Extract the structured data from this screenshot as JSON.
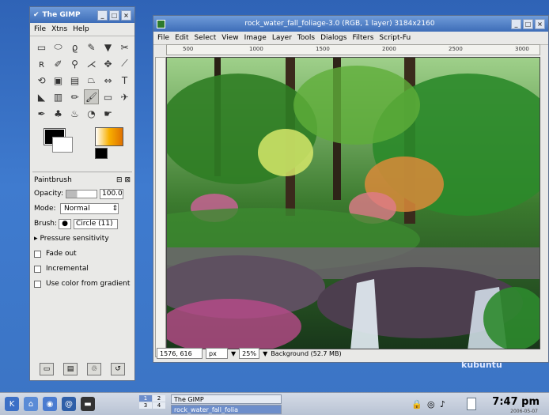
{
  "toolbox": {
    "title": "The GIMP",
    "menu": [
      "File",
      "Xtns",
      "Help"
    ],
    "tools": [
      "rect-select",
      "ellipse-select",
      "lasso",
      "fuzzy-select",
      "color-select",
      "scissors",
      "paths",
      "color-picker",
      "zoom",
      "measure",
      "move",
      "crop",
      "rotate",
      "scale",
      "shear",
      "perspective",
      "flip",
      "text",
      "bucket-fill",
      "blend",
      "pencil",
      "paintbrush",
      "eraser",
      "airbrush",
      "ink",
      "clone",
      "heal",
      "convolve",
      "smudge",
      ""
    ],
    "tool_glyphs": [
      "▭",
      "⬭",
      "ϱ",
      "✎",
      "▼",
      "✂",
      "ʀ",
      "✐",
      "⚲",
      "⋌",
      "✥",
      "⟋",
      "⟲",
      "▣",
      "▤",
      "⏢",
      "⇔",
      "T",
      "◣",
      "▥",
      "✏",
      "🖌",
      "▭",
      "✈",
      "✒",
      "♣",
      "♨",
      "◔",
      "☛",
      ""
    ],
    "selected_tool_index": 21,
    "options": {
      "title": "Paintbrush",
      "opacity_label": "Opacity:",
      "opacity_value": "100.0",
      "mode_label": "Mode:",
      "mode_value": "Normal",
      "brush_label": "Brush:",
      "brush_value": "Circle (11)",
      "pressure_label": "Pressure sensitivity",
      "fade_label": "Fade out",
      "incremental_label": "Incremental",
      "gradient_label": "Use color from gradient"
    }
  },
  "image_window": {
    "title": "rock_water_fall_foliage-3.0 (RGB, 1 layer) 3184x2160",
    "menu": [
      "File",
      "Edit",
      "Select",
      "View",
      "Image",
      "Layer",
      "Tools",
      "Dialogs",
      "Filters",
      "Script-Fu"
    ],
    "ruler_labels": [
      "500",
      "1000",
      "1500",
      "2000",
      "2500",
      "3000"
    ],
    "coords": "1576, 616",
    "unit": "px",
    "zoom": "25%",
    "status": "Background (52.7 MB)"
  },
  "desktop": {
    "brand": "kubuntu"
  },
  "taskbar": {
    "desktops": [
      "1",
      "2",
      "3",
      "4"
    ],
    "tasks": [
      "The GIMP",
      "rock_water_fall_folia"
    ],
    "clock": "7:47 pm",
    "date": "2006-05-07"
  }
}
